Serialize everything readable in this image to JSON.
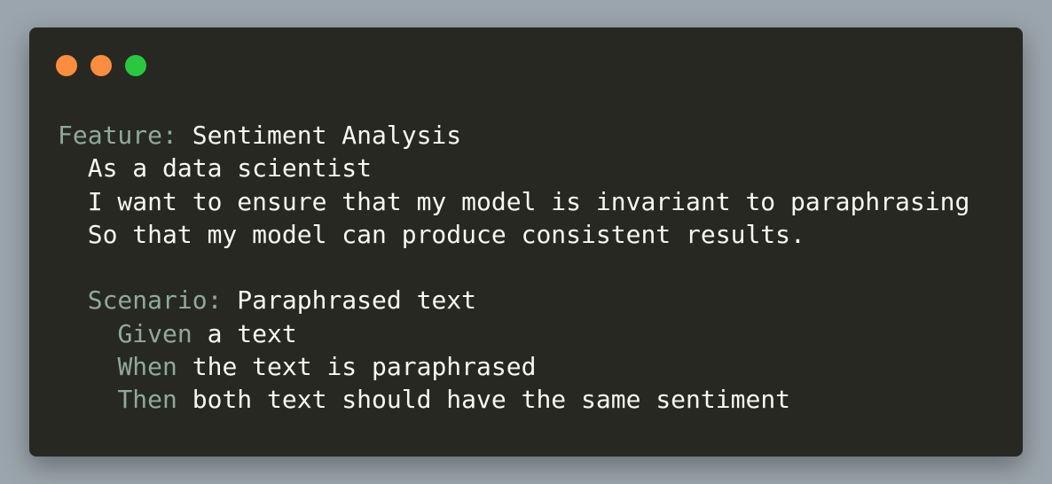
{
  "colors": {
    "background": "#9ba5ad",
    "window": "#272822",
    "text": "#f8f8f2",
    "keyword": "#90a99d",
    "dot_close": "#fc8d3e",
    "dot_minimize": "#fc8d3e",
    "dot_maximize": "#27c93f"
  },
  "code": {
    "feature_keyword": "Feature:",
    "feature_title": " Sentiment Analysis",
    "narrative": [
      "  As a data scientist",
      "  I want to ensure that my model is invariant to paraphrasing",
      "  So that my model can produce consistent results."
    ],
    "scenario_keyword": "Scenario:",
    "scenario_title": " Paraphrased text",
    "steps": [
      {
        "keyword": "Given",
        "text": " a text"
      },
      {
        "keyword": "When",
        "text": " the text is paraphrased"
      },
      {
        "keyword": "Then",
        "text": " both text should have the same sentiment"
      }
    ]
  }
}
